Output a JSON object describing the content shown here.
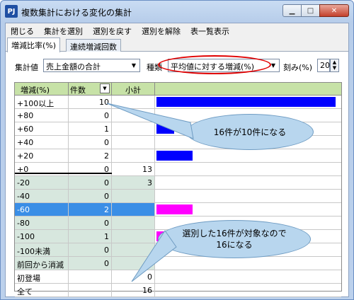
{
  "window": {
    "title": "複数集計における変化の集計",
    "app_icon": "PJ"
  },
  "menu": [
    "閉じる",
    "集計を選別",
    "選別を戻す",
    "選別を解除",
    "表一覧表示"
  ],
  "tabs": [
    "増減比率(%)",
    "連続増減回数"
  ],
  "controls": {
    "aggregate_label": "集計値",
    "aggregate_value": "売上金額の合計",
    "type_label": "種類",
    "type_value": "平均値に対する増減(%)",
    "step_label": "刻み(%)",
    "step_value": "20"
  },
  "grid": {
    "headers": {
      "label": "増減(%)",
      "count": "件数",
      "subtotal": "小計"
    },
    "rows": [
      {
        "label": "+100以上",
        "count": "10",
        "subtotal": "",
        "bar": 1.0,
        "bar_color": "#0000ff"
      },
      {
        "label": "+80",
        "count": "0",
        "subtotal": "",
        "bar": 0,
        "bar_color": "#0000ff"
      },
      {
        "label": "+60",
        "count": "1",
        "subtotal": "",
        "bar": 0.1,
        "bar_color": "#0000ff"
      },
      {
        "label": "+40",
        "count": "0",
        "subtotal": "",
        "bar": 0,
        "bar_color": "#0000ff"
      },
      {
        "label": "+20",
        "count": "2",
        "subtotal": "",
        "bar": 0.2,
        "bar_color": "#0000ff"
      },
      {
        "label": "+0",
        "count": "0",
        "subtotal": "13",
        "bar": 0,
        "bar_color": "#0000ff"
      },
      {
        "label": "-20",
        "count": "0",
        "subtotal": "3",
        "bar": 0,
        "bar_color": "#ff00ff"
      },
      {
        "label": "-40",
        "count": "0",
        "subtotal": "",
        "bar": 0,
        "bar_color": "#ff00ff"
      },
      {
        "label": "-60",
        "count": "2",
        "subtotal": "",
        "bar": 0.2,
        "bar_color": "#ff00ff",
        "selected": true
      },
      {
        "label": "-80",
        "count": "0",
        "subtotal": "",
        "bar": 0,
        "bar_color": "#ff00ff"
      },
      {
        "label": "-100",
        "count": "1",
        "subtotal": "",
        "bar": 0.1,
        "bar_color": "#ff00ff"
      },
      {
        "label": "-100未満",
        "count": "0",
        "subtotal": "",
        "bar": 0,
        "bar_color": "#ff00ff"
      },
      {
        "label": "前回から消滅",
        "count": "0",
        "subtotal": "",
        "bar": 0,
        "bar_color": "#ff00ff"
      },
      {
        "label": "初登場",
        "count": "",
        "subtotal": "0",
        "bar": 0,
        "bar_color": "#ff00ff"
      },
      {
        "label": "全て",
        "count": "",
        "subtotal": "16",
        "bar": 0,
        "bar_color": "#ff00ff"
      }
    ]
  },
  "callouts": {
    "top": "16件が10件になる",
    "bottom_line1": "選別した16件が対象なので",
    "bottom_line2": "16になる"
  },
  "colors": {
    "header_bg": "#c7e2a7",
    "selected_row": "#3a8ee6",
    "positive_bar": "#0000ff",
    "negative_bar": "#ff00ff",
    "oval": "#e00000"
  }
}
